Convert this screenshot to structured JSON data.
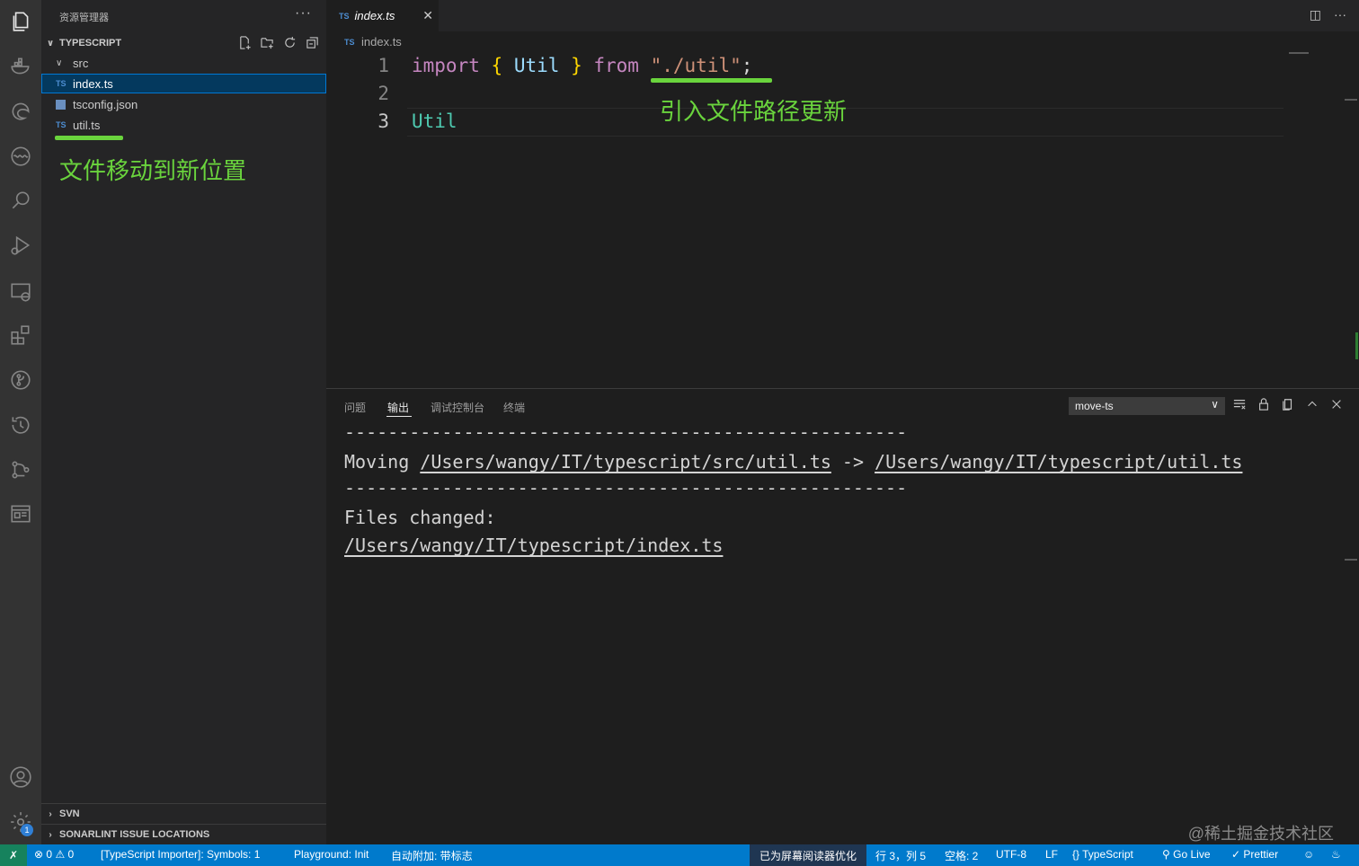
{
  "sidebar": {
    "title": "资源管理器",
    "more": "···",
    "project": "TYPESCRIPT",
    "folder": "src",
    "files": [
      {
        "label": "index.ts",
        "type": "TS"
      },
      {
        "label": "tsconfig.json",
        "type": "json"
      },
      {
        "label": "util.ts",
        "type": "TS"
      }
    ],
    "annotation": "文件移动到新位置",
    "sections": [
      "SVN",
      "SONARLINT ISSUE LOCATIONS"
    ]
  },
  "activity": {
    "icons": [
      "files-icon",
      "docker-icon",
      "edge-icon",
      "wave-icon",
      "search-icon",
      "run-debug-icon",
      "remote-explorer-icon",
      "extensions-icon",
      "source-control-icon",
      "timeline-icon",
      "git-graph-icon",
      "preview-icon",
      "account-icon",
      "settings-icon"
    ],
    "settings_badge": "1"
  },
  "editor": {
    "tab_label": "index.ts",
    "tab_icon": "TS",
    "breadcrumb": "index.ts",
    "line_numbers": [
      "1",
      "2",
      "3"
    ],
    "line1": {
      "import": "import",
      "lbrace": "{",
      "name": "Util",
      "rbrace": "}",
      "from": "from",
      "path": "\"./util\"",
      "semi": ";"
    },
    "line3": "Util",
    "annotation": "引入文件路径更新"
  },
  "panel": {
    "tabs": [
      "问题",
      "输出",
      "调试控制台",
      "终端"
    ],
    "active_tab": "输出",
    "channel": "move-ts",
    "output": {
      "dashes": "----------------------------------------------------",
      "moving_label": "Moving",
      "from_path": "/Users/wangy/IT/typescript/src/util.ts",
      "arrow": "->",
      "to_path": "/Users/wangy/IT/typescript/util.ts",
      "files_changed": "Files changed:",
      "changed_file": "/Users/wangy/IT/typescript/index.ts"
    }
  },
  "status": {
    "errors": "0",
    "warnings": "0",
    "importer": "[TypeScript Importer]: Symbols: 1",
    "playground": "Playground: Init",
    "auto_attach": "自动附加: 带标志",
    "screen_reader": "已为屏幕阅读器优化",
    "position": "行 3，列 5",
    "spaces": "空格: 2",
    "encoding": "UTF-8",
    "eol": "LF",
    "language": "TypeScript",
    "go_live": "Go Live",
    "prettier": "Prettier"
  },
  "watermark": "@稀土掘金技术社区",
  "colors": {
    "accent_green": "#6ad43d",
    "status_blue": "#007acc",
    "selection": "#04395e"
  }
}
